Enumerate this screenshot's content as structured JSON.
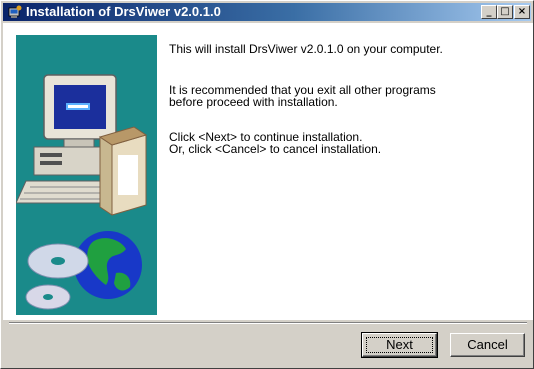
{
  "window": {
    "title": "Installation of DrsViwer v2.0.1.0",
    "controls": {
      "minimize": "_",
      "maximize": "□",
      "close": "×"
    }
  },
  "content": {
    "lines": [
      "This will install DrsViwer v2.0.1.0 on your computer.",
      "It is recommended that you exit all other programs",
      "before proceed with installation.",
      "Click <Next> to continue installation.",
      "Or, click <Cancel> to cancel installation."
    ]
  },
  "buttons": {
    "next": "Next",
    "cancel": "Cancel"
  },
  "colors": {
    "titlebar_start": "#0a246a",
    "titlebar_end": "#a6caf0",
    "side_panel": "#1a8a8a",
    "dialog_face": "#d4d0c8"
  },
  "icons": {
    "title": "installer-icon",
    "illustration": "computer-and-globe-illustration"
  }
}
